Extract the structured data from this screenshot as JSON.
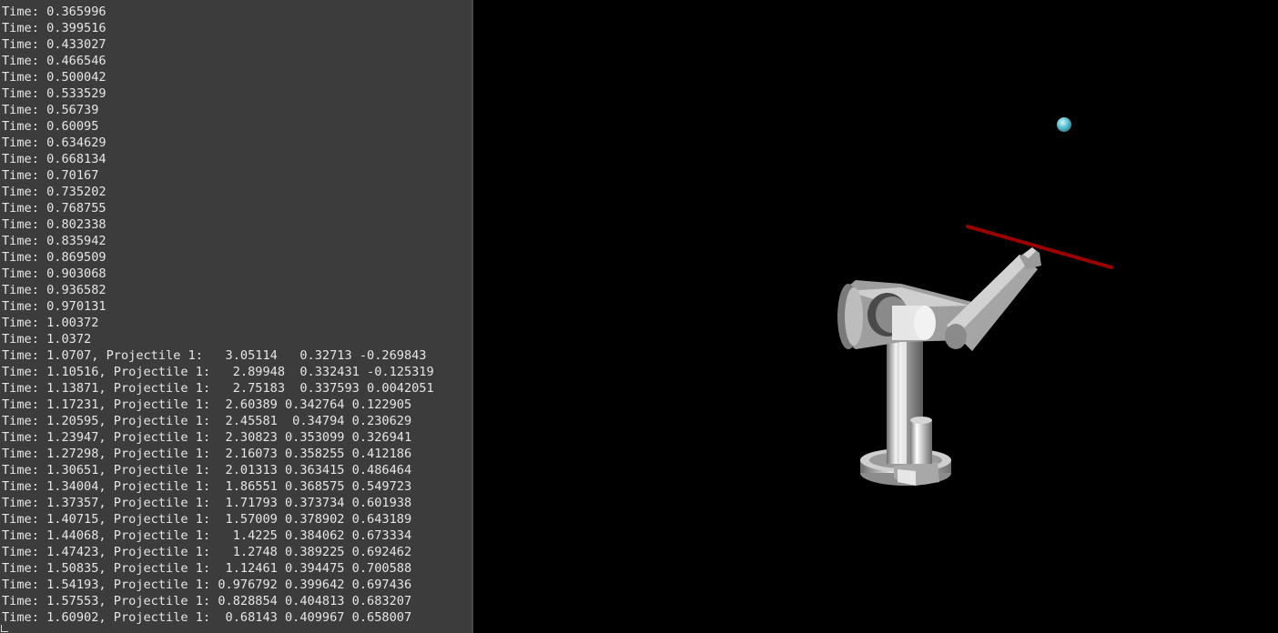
{
  "console": {
    "lines": [
      "Time: 0.365996",
      "Time: 0.399516",
      "Time: 0.433027",
      "Time: 0.466546",
      "Time: 0.500042",
      "Time: 0.533529",
      "Time: 0.56739",
      "Time: 0.60095",
      "Time: 0.634629",
      "Time: 0.668134",
      "Time: 0.70167",
      "Time: 0.735202",
      "Time: 0.768755",
      "Time: 0.802338",
      "Time: 0.835942",
      "Time: 0.869509",
      "Time: 0.903068",
      "Time: 0.936582",
      "Time: 0.970131",
      "Time: 1.00372",
      "Time: 1.0372",
      "Time: 1.0707, Projectile 1:   3.05114   0.32713 -0.269843",
      "Time: 1.10516, Projectile 1:   2.89948  0.332431 -0.125319",
      "Time: 1.13871, Projectile 1:   2.75183  0.337593 0.0042051",
      "Time: 1.17231, Projectile 1:  2.60389 0.342764 0.122905",
      "Time: 1.20595, Projectile 1:  2.45581  0.34794 0.230629",
      "Time: 1.23947, Projectile 1:  2.30823 0.353099 0.326941",
      "Time: 1.27298, Projectile 1:  2.16073 0.358255 0.412186",
      "Time: 1.30651, Projectile 1:  2.01313 0.363415 0.486464",
      "Time: 1.34004, Projectile 1:  1.86551 0.368575 0.549723",
      "Time: 1.37357, Projectile 1:  1.71793 0.373734 0.601938",
      "Time: 1.40715, Projectile 1:  1.57009 0.378902 0.643189",
      "Time: 1.44068, Projectile 1:   1.4225 0.384062 0.673334",
      "Time: 1.47423, Projectile 1:   1.2748 0.389225 0.692462",
      "Time: 1.50835, Projectile 1:  1.12461 0.394475 0.700588",
      "Time: 1.54193, Projectile 1: 0.976792 0.399642 0.697436",
      "Time: 1.57553, Projectile 1: 0.828854 0.404813 0.683207",
      "Time: 1.60902, Projectile 1:  0.68143 0.409967 0.658007"
    ]
  },
  "scene": {
    "background_color": "#000000",
    "robot_color": "#b8b8b8",
    "paddle_color": "#a30000",
    "projectile_color": "#5fc4d6"
  }
}
